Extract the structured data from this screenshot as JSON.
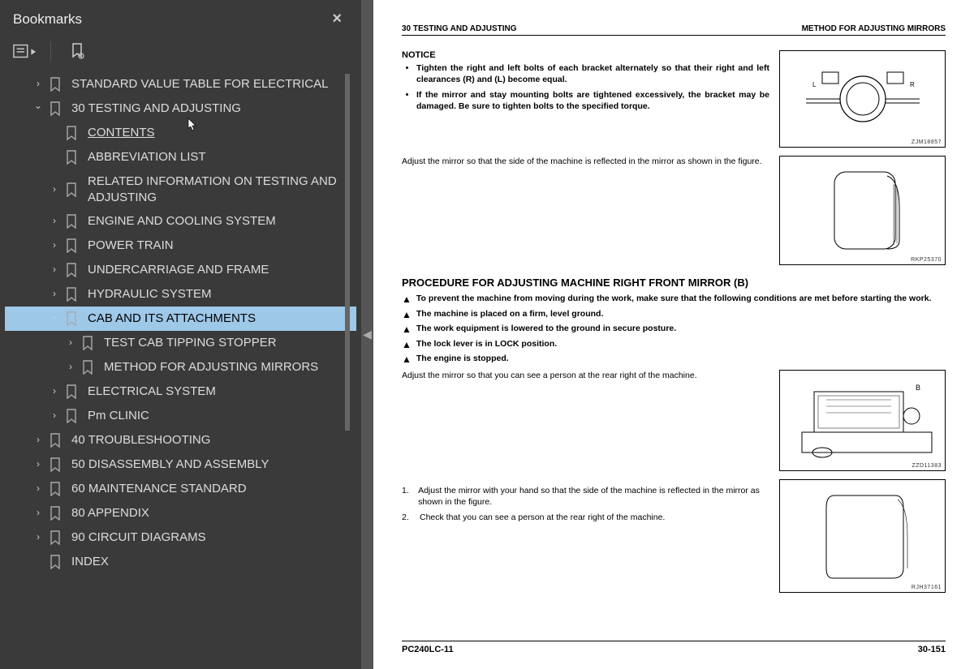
{
  "sidebar": {
    "title": "Bookmarks",
    "items": [
      {
        "indent": 1,
        "arrow": "right",
        "label": "STANDARD VALUE TABLE FOR ELECTRICAL"
      },
      {
        "indent": 1,
        "arrow": "down",
        "label": "30 TESTING AND ADJUSTING"
      },
      {
        "indent": 2,
        "arrow": "blank",
        "label": "CONTENTS",
        "underline": true
      },
      {
        "indent": 2,
        "arrow": "blank",
        "label": "ABBREVIATION LIST"
      },
      {
        "indent": 2,
        "arrow": "right",
        "label": "RELATED INFORMATION ON TESTING AND ADJUSTING"
      },
      {
        "indent": 2,
        "arrow": "right",
        "label": "ENGINE AND COOLING SYSTEM"
      },
      {
        "indent": 2,
        "arrow": "right",
        "label": "POWER TRAIN"
      },
      {
        "indent": 2,
        "arrow": "right",
        "label": "UNDERCARRIAGE AND FRAME"
      },
      {
        "indent": 2,
        "arrow": "right",
        "label": "HYDRAULIC SYSTEM"
      },
      {
        "indent": 2,
        "arrow": "down",
        "label": "CAB AND ITS ATTACHMENTS",
        "selected": true
      },
      {
        "indent": 3,
        "arrow": "right",
        "label": "TEST CAB TIPPING STOPPER"
      },
      {
        "indent": 3,
        "arrow": "right",
        "label": "METHOD FOR ADJUSTING MIRRORS"
      },
      {
        "indent": 2,
        "arrow": "right",
        "label": "ELECTRICAL SYSTEM"
      },
      {
        "indent": 2,
        "arrow": "right",
        "label": "Pm CLINIC"
      },
      {
        "indent": 1,
        "arrow": "right",
        "label": "40 TROUBLESHOOTING"
      },
      {
        "indent": 1,
        "arrow": "right",
        "label": "50 DISASSEMBLY AND ASSEMBLY"
      },
      {
        "indent": 1,
        "arrow": "right",
        "label": "60 MAINTENANCE STANDARD"
      },
      {
        "indent": 1,
        "arrow": "right",
        "label": "80 APPENDIX"
      },
      {
        "indent": 1,
        "arrow": "right",
        "label": "90 CIRCUIT DIAGRAMS"
      },
      {
        "indent": 1,
        "arrow": "blank",
        "label": "INDEX"
      }
    ]
  },
  "page": {
    "header_left": "30 TESTING AND ADJUSTING",
    "header_right": "METHOD FOR ADJUSTING MIRRORS",
    "notice_title": "NOTICE",
    "notice_bullets": [
      "Tighten the right and left bolts of each bracket alternately so that their right and left clearances (R) and (L) become equal.",
      "If the mirror and stay mounting bolts are tightened excessively, the bracket may be damaged. Be sure to tighten bolts to the specified torque."
    ],
    "fig1_id": "ZJM18857",
    "adjust_text": "Adjust the mirror so that the side of the machine is reflected in the mirror as shown in the figure.",
    "fig2_id": "RKP25370",
    "section_title": "PROCEDURE FOR ADJUSTING MACHINE RIGHT FRONT MIRROR (B)",
    "warnings": [
      "To prevent the machine from moving during the work, make sure that the following conditions are met before starting the work.",
      "The machine is placed on a firm, level ground.",
      "The work equipment is lowered to the ground in secure posture.",
      "The lock lever is in LOCK position.",
      "The engine is stopped."
    ],
    "after_warn": "Adjust the mirror so that you can see a person at the rear right of the machine.",
    "fig3_id": "ZZD11383",
    "steps": [
      "Adjust the mirror with your hand so that the side of the machine is reflected in the mirror as shown in the figure.",
      "Check that you can see a person at the rear right of the machine."
    ],
    "fig4_id": "RJH37161",
    "footer_left": "PC240LC-11",
    "footer_right": "30-151"
  }
}
